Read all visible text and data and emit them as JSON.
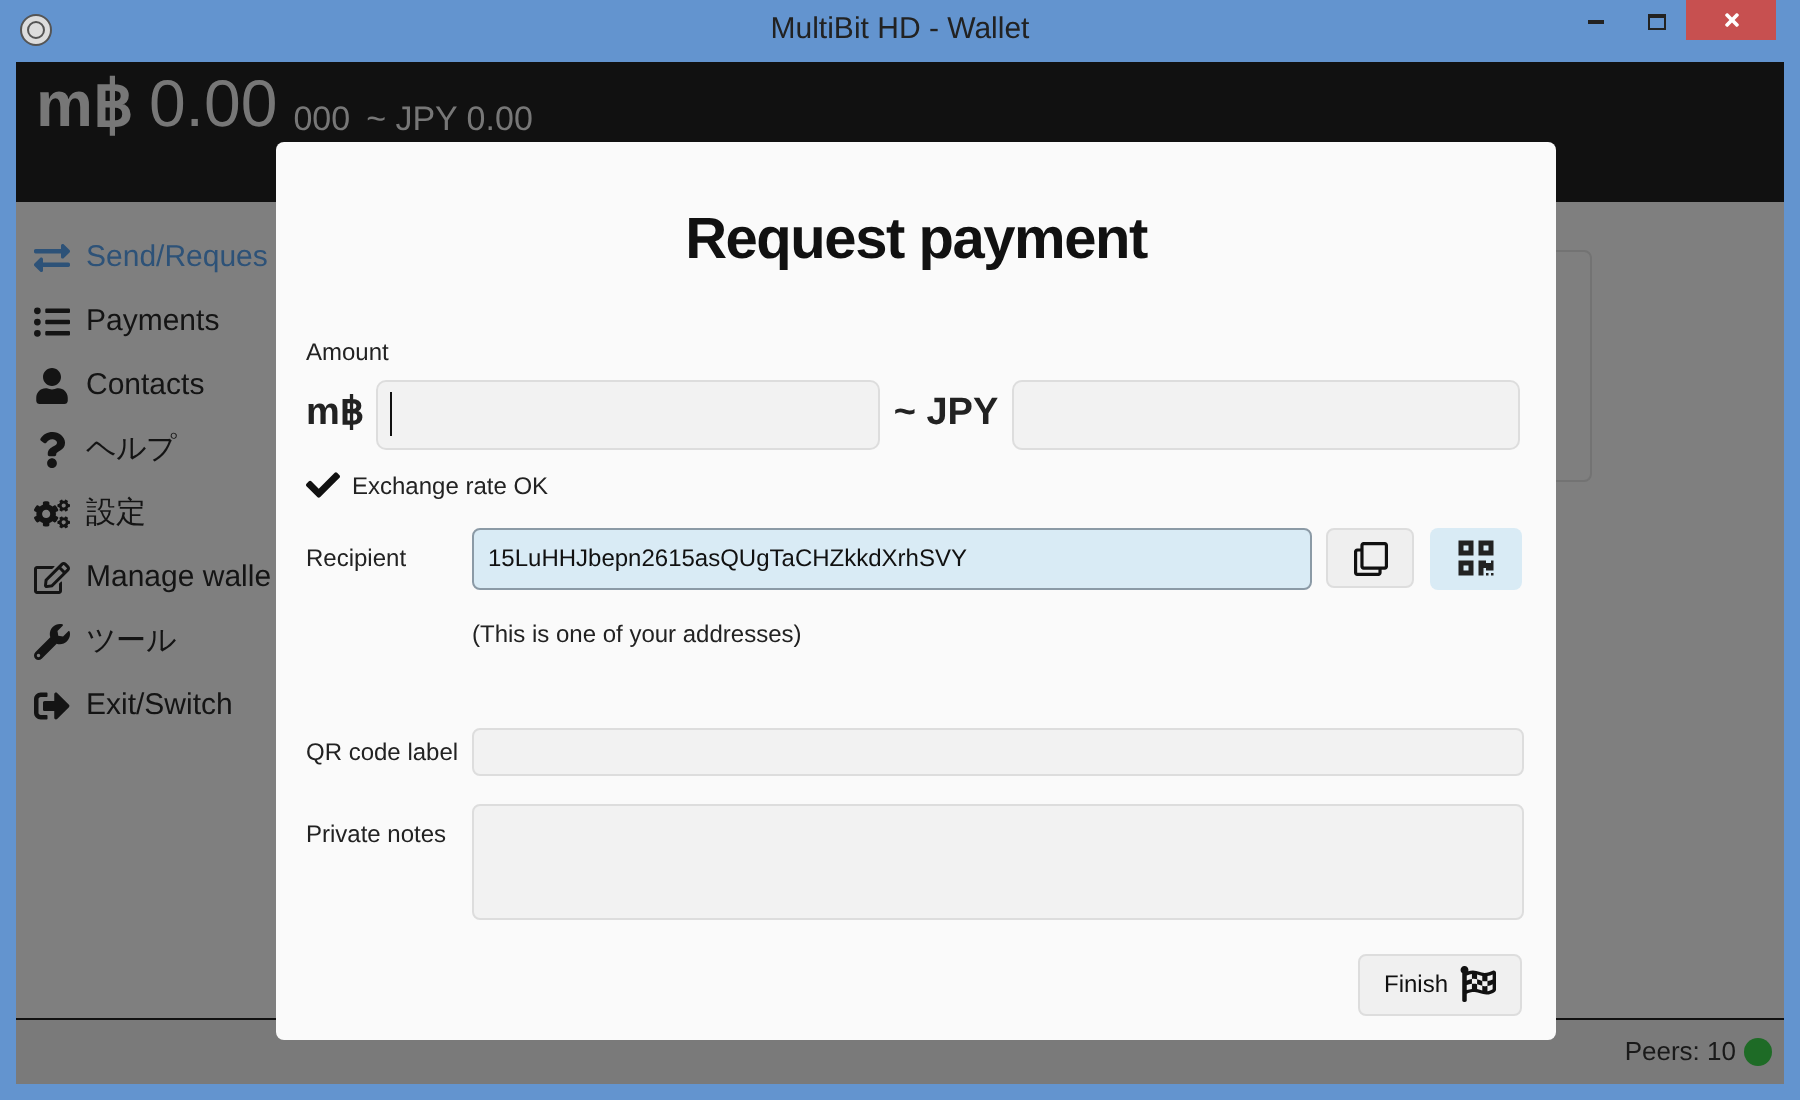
{
  "window": {
    "title": "MultiBit HD - Wallet"
  },
  "header": {
    "symbol": "m฿",
    "balance": "0.00",
    "fraction": "000",
    "local": "~ JPY 0.00"
  },
  "sidebar": {
    "items": [
      {
        "label": "Send/Reques",
        "kind": "exchange",
        "selected": true
      },
      {
        "label": "Payments",
        "kind": "list",
        "selected": false
      },
      {
        "label": "Contacts",
        "kind": "user",
        "selected": false
      },
      {
        "label": "ヘルプ",
        "kind": "help",
        "selected": false
      },
      {
        "label": "設定",
        "kind": "settings",
        "selected": false
      },
      {
        "label": "Manage walle",
        "kind": "edit",
        "selected": false
      },
      {
        "label": "ツール",
        "kind": "wrench",
        "selected": false
      },
      {
        "label": "Exit/Switch",
        "kind": "exit",
        "selected": false
      }
    ]
  },
  "dialog": {
    "title": "Request payment",
    "amount": {
      "label": "Amount",
      "symbol": "m฿",
      "focused": true,
      "local_label": "~ JPY"
    },
    "exchange_status": {
      "ok": true,
      "text": "Exchange rate OK"
    },
    "recipient": {
      "label": "Recipient",
      "value": "15LuHHJbepn2615asQUgTaCHZkkdXrhSVY",
      "note": "(This is one of your addresses)"
    },
    "qr_code_label": {
      "label": "QR code label"
    },
    "private_notes": {
      "label": "Private notes"
    },
    "finish_button": "Finish"
  },
  "status_bar": {
    "peers": "Peers: 10",
    "color": "#1e6b26"
  }
}
